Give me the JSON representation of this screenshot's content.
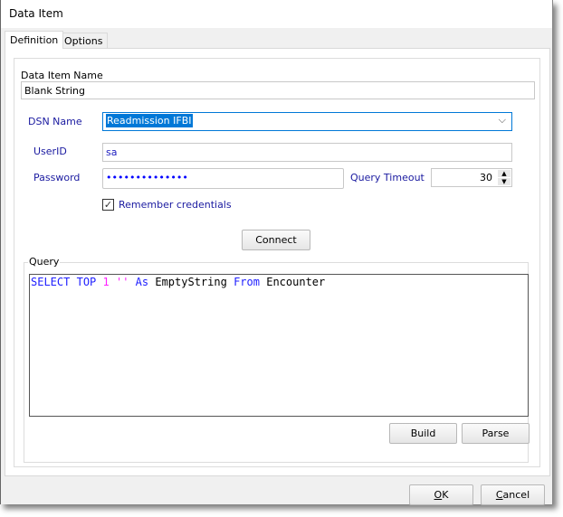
{
  "window": {
    "title": "Data Item"
  },
  "tabs": [
    {
      "label": "Definition",
      "active": true
    },
    {
      "label": "Options",
      "active": false
    }
  ],
  "form": {
    "name_label": "Data Item Name",
    "name_value": "Blank String",
    "dsn_label": "DSN Name",
    "dsn_value": "Readmission IFBI",
    "userid_label": "UserID",
    "userid_value": "sa",
    "password_label": "Password",
    "password_value": "••••••••••••••",
    "timeout_label": "Query Timeout",
    "timeout_value": "30",
    "remember_label": "Remember credentials",
    "remember_checked": true,
    "connect_label": "Connect"
  },
  "query": {
    "group_label": "Query",
    "tokens": [
      {
        "text": "SELECT",
        "color": "#2020ff"
      },
      {
        "text": " "
      },
      {
        "text": "TOP",
        "color": "#2020ff"
      },
      {
        "text": " "
      },
      {
        "text": "1",
        "color": "#ff20ff"
      },
      {
        "text": " "
      },
      {
        "text": "''",
        "color": "#ff20ff"
      },
      {
        "text": " "
      },
      {
        "text": "As",
        "color": "#2020ff"
      },
      {
        "text": " "
      },
      {
        "text": "EmptyString",
        "color": "#000000"
      },
      {
        "text": " "
      },
      {
        "text": "From",
        "color": "#2020ff"
      },
      {
        "text": " "
      },
      {
        "text": "Encounter",
        "color": "#000000"
      }
    ],
    "build_label": "Build",
    "parse_label": "Parse"
  },
  "footer": {
    "ok_mnemonic": "O",
    "ok_rest": "K",
    "cancel_mnemonic": "C",
    "cancel_rest": "ancel"
  },
  "colors": {
    "accent": "#0078d7",
    "label_blue": "#1a1aa0",
    "selection": "#0078d7"
  }
}
